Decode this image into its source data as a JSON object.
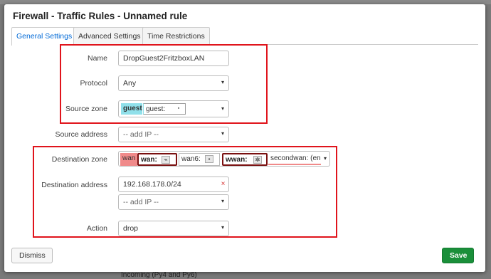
{
  "background": {
    "bottom_text": "Incoming (Py4 and Py6)"
  },
  "modal": {
    "title": "Firewall - Traffic Rules - Unnamed rule"
  },
  "tabs": [
    {
      "label": "General Settings",
      "active": true
    },
    {
      "label": "Advanced Settings",
      "active": false
    },
    {
      "label": "Time Restrictions",
      "active": false
    }
  ],
  "form": {
    "name": {
      "label": "Name",
      "value": "DropGuest2FritzboxLAN"
    },
    "protocol": {
      "label": "Protocol",
      "value": "Any"
    },
    "source_zone": {
      "label": "Source zone",
      "tag": "guest",
      "value": "guest:"
    },
    "source_address": {
      "label": "Source address",
      "placeholder": "-- add IP --"
    },
    "destination_zone": {
      "label": "Destination zone",
      "tag": "wan",
      "items": [
        "wan:",
        "wan6:",
        "wwan:",
        "secondwan: (en"
      ]
    },
    "destination_address": {
      "label": "Destination address",
      "value": "192.168.178.0/24",
      "clear": "×",
      "placeholder": "-- add IP --"
    },
    "action": {
      "label": "Action",
      "value": "drop"
    }
  },
  "buttons": {
    "dismiss": "Dismiss",
    "save": "Save"
  },
  "icons": {
    "select_arrow": "▾"
  },
  "colors": {
    "highlight_box": "#e0141c",
    "guest_zone": "#90e0ea",
    "wan_zone": "#f08a8a",
    "save_button": "#1a8f3a",
    "active_tab_text": "#0069d6"
  }
}
